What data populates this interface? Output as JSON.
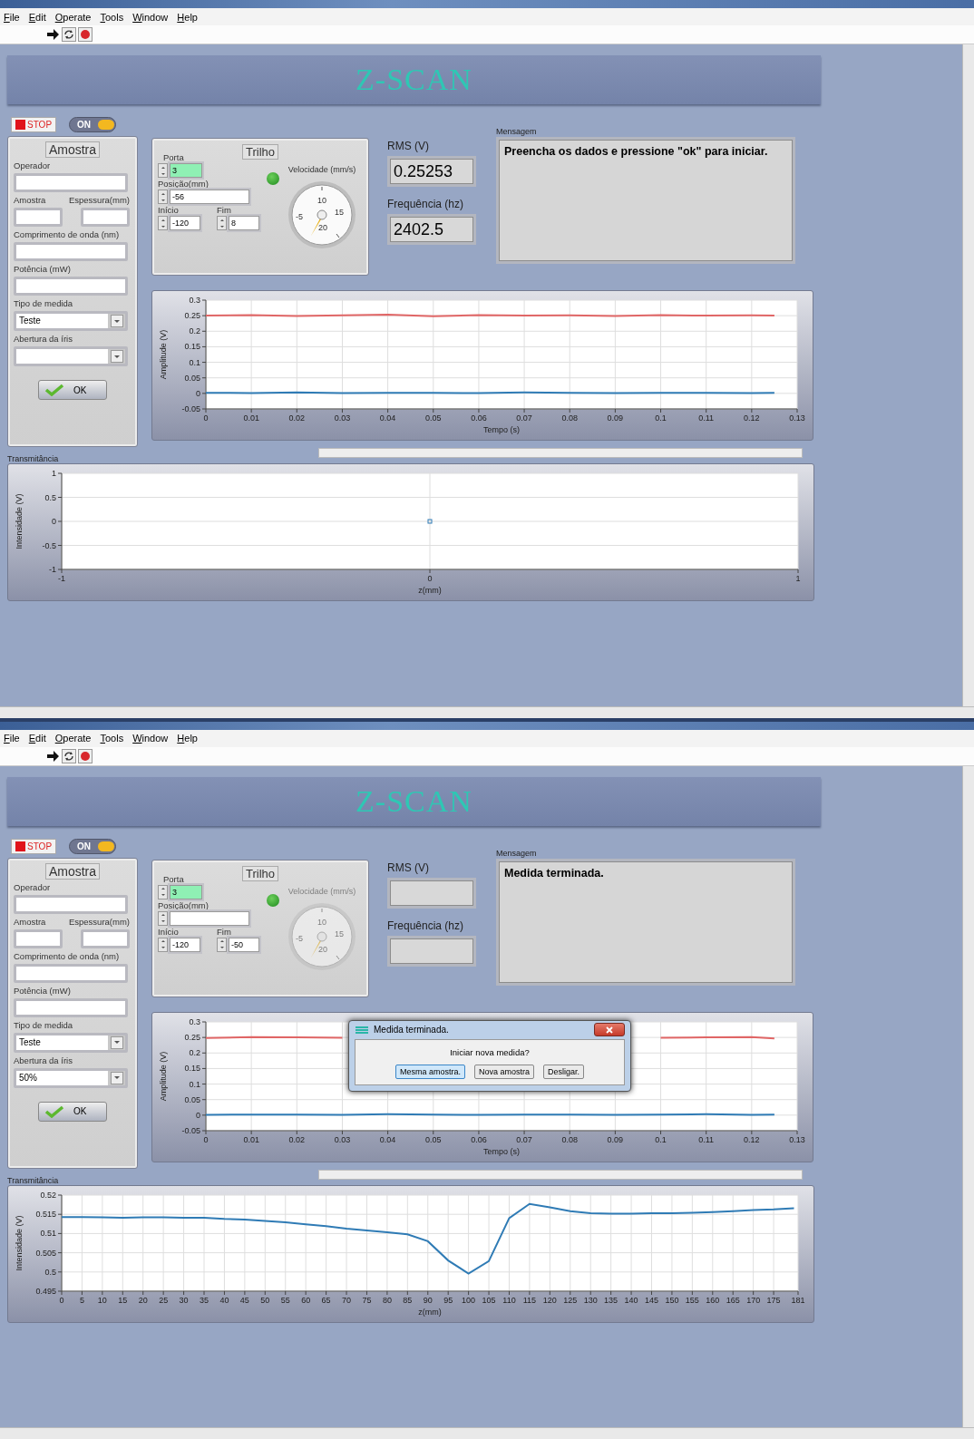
{
  "screens": [
    {
      "menu": [
        "File",
        "Edit",
        "Operate",
        "Tools",
        "Window",
        "Help"
      ],
      "banner": "Z-SCAN",
      "stop_button": "STOP",
      "power_switch": {
        "label": "ON",
        "on": true
      },
      "amostra": {
        "title": "Amostra",
        "operador_label": "Operador",
        "amostra_label": "Amostra",
        "espessura_label": "Espessura(mm)",
        "comprimento_label": "Comprimento de onda (nm)",
        "potencia_label": "Potência (mW)",
        "tipo_label": "Tipo de medida",
        "tipo_value": "Teste",
        "abertura_label": "Abertura da íris",
        "ok_button": "OK"
      },
      "trilho": {
        "title": "Trilho",
        "porta_label": "Porta",
        "porta_value": "3",
        "led_on": true,
        "posicao_label": "Posição(mm)",
        "posicao_value": "-56",
        "inicio_label": "Início",
        "inicio_value": "-120",
        "fim_label": "Fim",
        "fim_value": "8",
        "gauge": {
          "label": "Velocidade  (mm/s)",
          "disabled": false,
          "ticks": [
            "-5",
            "10",
            "15",
            "20"
          ]
        }
      },
      "rms": {
        "label": "RMS (V)",
        "value": "0.25253"
      },
      "frequencia": {
        "label": "Frequência (hz)",
        "value": "2402.5"
      },
      "mensagem": {
        "label": "Mensagem",
        "text": "Preencha os dados e pressione \"ok\" para iniciar."
      },
      "amplitude_chart": {
        "chart_data": {
          "type": "line",
          "grid": true,
          "xlabel": "Tempo (s)",
          "ylabel": "Amplitude (V)",
          "x": [
            0,
            0.01,
            0.02,
            0.03,
            0.04,
            0.05,
            0.06,
            0.07,
            0.08,
            0.09,
            0.1,
            0.11,
            0.12,
            0.125
          ],
          "xlim": [
            0,
            0.13
          ],
          "ylim": [
            -0.05,
            0.3
          ],
          "xticks": [
            0,
            0.01,
            0.02,
            0.03,
            0.04,
            0.05,
            0.06,
            0.07,
            0.08,
            0.09,
            0.1,
            0.11,
            0.12,
            0.13
          ],
          "yticks": [
            -0.05,
            0,
            0.05,
            0.1,
            0.15,
            0.2,
            0.25,
            0.3
          ],
          "series": [
            {
              "color": "#e06666",
              "values": [
                0.25,
                0.252,
                0.249,
                0.251,
                0.253,
                0.248,
                0.252,
                0.25,
                0.251,
                0.249,
                0.252,
                0.25,
                0.251,
                0.25
              ]
            },
            {
              "color": "#2f7bb5",
              "values": [
                0.002,
                0.001,
                0.003,
                0.001,
                0.002,
                0.002,
                0.001,
                0.003,
                0.002,
                0.001,
                0.002,
                0.002,
                0.001,
                0.002
              ]
            }
          ]
        }
      },
      "transmitancia": {
        "label": "Transmitância",
        "chart_data": {
          "type": "scatter",
          "grid": true,
          "xlabel": "z(mm)",
          "ylabel": "Intensidade (V)",
          "x": [
            0
          ],
          "xlim": [
            -1,
            1
          ],
          "ylim": [
            -1,
            1
          ],
          "xticks": [
            -1,
            0,
            1
          ],
          "yticks": [
            -1,
            -0.5,
            0,
            0.5,
            1
          ],
          "series": [
            {
              "color": "#2f7bb5",
              "values": [
                0
              ]
            }
          ]
        }
      }
    },
    {
      "menu": [
        "File",
        "Edit",
        "Operate",
        "Tools",
        "Window",
        "Help"
      ],
      "banner": "Z-SCAN",
      "stop_button": "STOP",
      "power_switch": {
        "label": "ON",
        "on": true
      },
      "amostra": {
        "title": "Amostra",
        "operador_label": "Operador",
        "amostra_label": "Amostra",
        "espessura_label": "Espessura(mm)",
        "comprimento_label": "Comprimento de onda (nm)",
        "potencia_label": "Potência (mW)",
        "tipo_label": "Tipo de medida",
        "tipo_value": "Teste",
        "abertura_label": "Abertura da íris",
        "abertura_value": "50%",
        "ok_button": "OK"
      },
      "trilho": {
        "title": "Trilho",
        "porta_label": "Porta",
        "porta_value": "3",
        "led_on": true,
        "posicao_label": "Posição(mm)",
        "inicio_label": "Início",
        "inicio_value": "-120",
        "fim_label": "Fim",
        "fim_value": "-50",
        "gauge": {
          "label": "Velocidade  (mm/s)",
          "disabled": true,
          "ticks": [
            "-5",
            "10",
            "15",
            "20"
          ]
        }
      },
      "rms": {
        "label": "RMS (V)"
      },
      "frequencia": {
        "label": "Frequência (hz)"
      },
      "mensagem": {
        "label": "Mensagem",
        "text": "Medida terminada."
      },
      "amplitude_chart": {
        "chart_data": {
          "type": "line",
          "grid": true,
          "xlabel": "Tempo (s)",
          "ylabel": "Amplitude (V)",
          "x": [
            0,
            0.01,
            0.02,
            0.03,
            0.04,
            0.05,
            0.06,
            0.07,
            0.08,
            0.09,
            0.1,
            0.11,
            0.12,
            0.125
          ],
          "xlim": [
            0,
            0.13
          ],
          "ylim": [
            -0.05,
            0.3
          ],
          "xticks": [
            0,
            0.01,
            0.02,
            0.03,
            0.04,
            0.05,
            0.06,
            0.07,
            0.08,
            0.09,
            0.1,
            0.11,
            0.12,
            0.13
          ],
          "yticks": [
            -0.05,
            0,
            0.05,
            0.1,
            0.15,
            0.2,
            0.25,
            0.3
          ],
          "series": [
            {
              "color": "#e06666",
              "values": [
                0.248,
                0.251,
                0.25,
                0.249,
                null,
                null,
                null,
                null,
                null,
                null,
                0.249,
                0.25,
                0.251,
                0.247
              ]
            },
            {
              "color": "#2f7bb5",
              "values": [
                0.001,
                0.002,
                0.002,
                0.001,
                0.003,
                0.002,
                0.001,
                0.002,
                0.002,
                0.001,
                0.002,
                0.003,
                0.001,
                0.002
              ]
            }
          ]
        },
        "dialog": {
          "title": "Medida terminada.",
          "question": "Iniciar nova medida?",
          "buttons": [
            {
              "label": "Mesma amostra.",
              "selected": true
            },
            {
              "label": "Nova amostra",
              "selected": false
            },
            {
              "label": "Desligar.",
              "selected": false
            }
          ]
        }
      },
      "transmitancia": {
        "label": "Transmitância",
        "chart_data": {
          "type": "line",
          "grid": true,
          "xlabel": "z(mm)",
          "ylabel": "Intensidade (V)",
          "x": [
            0,
            5,
            10,
            15,
            20,
            25,
            30,
            35,
            40,
            45,
            50,
            55,
            60,
            65,
            70,
            75,
            80,
            85,
            90,
            95,
            100,
            105,
            110,
            115,
            120,
            125,
            130,
            135,
            140,
            145,
            150,
            155,
            160,
            165,
            170,
            175,
            180
          ],
          "xlim": [
            0,
            181
          ],
          "ylim": [
            0.495,
            0.52
          ],
          "xticks": [
            0,
            5,
            10,
            15,
            20,
            25,
            30,
            35,
            40,
            45,
            50,
            55,
            60,
            65,
            70,
            75,
            80,
            85,
            90,
            95,
            100,
            105,
            110,
            115,
            120,
            125,
            130,
            135,
            140,
            145,
            150,
            155,
            160,
            165,
            170,
            175,
            181
          ],
          "yticks": [
            0.495,
            0.5,
            0.505,
            0.51,
            0.515,
            0.52
          ],
          "series": [
            {
              "color": "#2f7bb5",
              "values": [
                0.5143,
                0.5143,
                0.5142,
                0.5141,
                0.5142,
                0.5142,
                0.5141,
                0.5141,
                0.5138,
                0.5136,
                0.5133,
                0.5129,
                0.5124,
                0.5119,
                0.5113,
                0.5108,
                0.5103,
                0.5098,
                0.508,
                0.503,
                0.4996,
                0.5028,
                0.514,
                0.5177,
                0.5168,
                0.5158,
                0.5153,
                0.5152,
                0.5152,
                0.5153,
                0.5153,
                0.5154,
                0.5156,
                0.5158,
                0.5161,
                0.5163,
                0.5166
              ]
            }
          ]
        }
      }
    }
  ]
}
